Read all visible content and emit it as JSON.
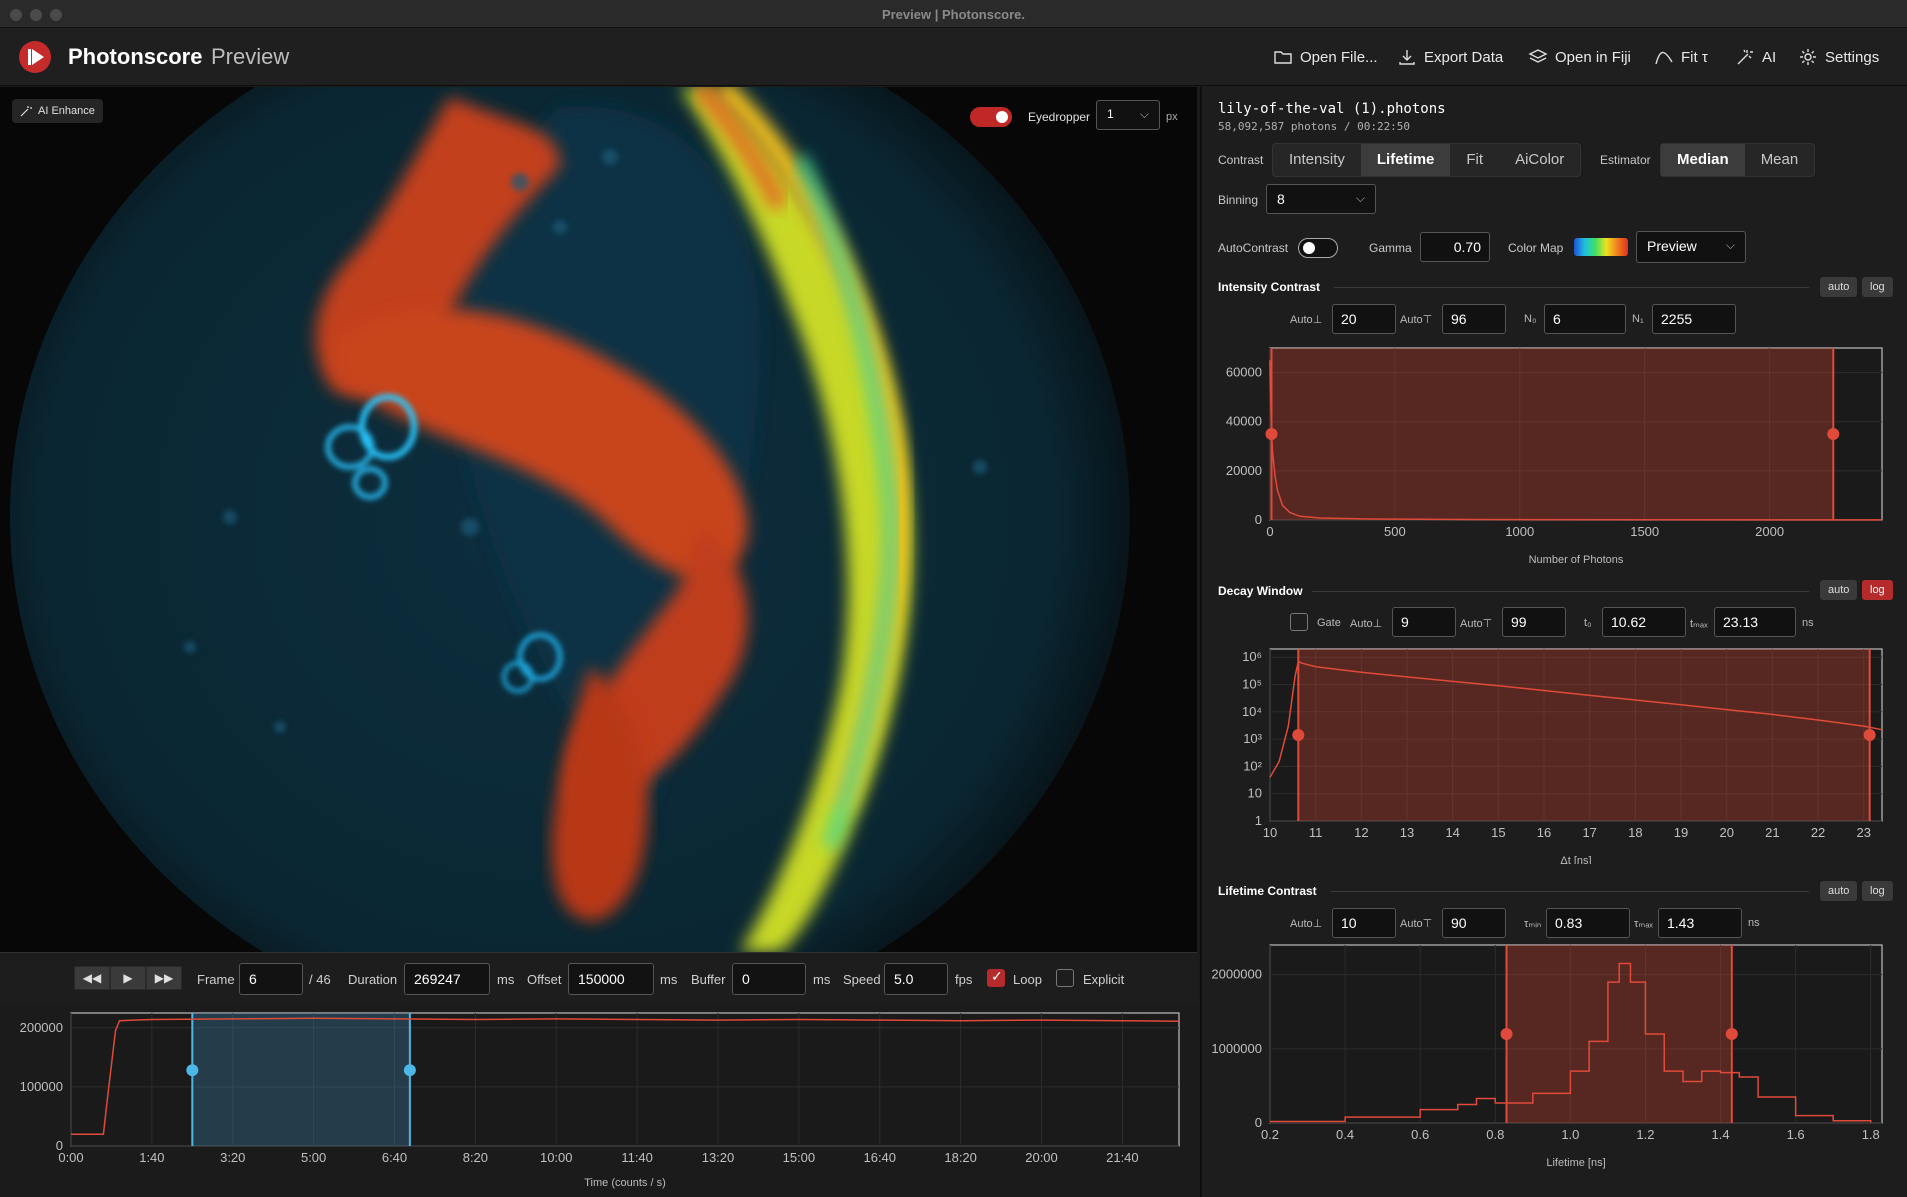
{
  "window_title": "Preview | Photonscore.",
  "app": {
    "brand": "Photonscore",
    "mode": "Preview"
  },
  "toolbar": [
    {
      "label": "Open File...",
      "icon": "folder-icon"
    },
    {
      "label": "Export Data",
      "icon": "download-icon"
    },
    {
      "label": "Open in Fiji",
      "icon": "layers-icon"
    },
    {
      "label": "Fit τ",
      "icon": "curve-icon"
    },
    {
      "label": "AI",
      "icon": "magic-wand-icon"
    },
    {
      "label": "Settings",
      "icon": "gear-icon"
    }
  ],
  "image_panel": {
    "ai_enhance_label": "AI Enhance",
    "eyedropper_label": "Eyedropper",
    "eyedropper_size": "1",
    "eyedropper_unit": "px",
    "eyedropper_on": true
  },
  "playback": {
    "frame_label": "Frame",
    "frame": "6",
    "frame_total": "/ 46",
    "duration_label": "Duration",
    "duration": "269247",
    "duration_unit": "ms",
    "offset_label": "Offset",
    "offset": "150000",
    "offset_unit": "ms",
    "buffer_label": "Buffer",
    "buffer": "0",
    "buffer_unit": "ms",
    "speed_label": "Speed",
    "speed": "5.0",
    "speed_unit": "fps",
    "loop_label": "Loop",
    "loop_checked": true,
    "explicit_label": "Explicit",
    "explicit_checked": false
  },
  "file": {
    "name": "lily-of-the-val (1).photons",
    "meta": "58,092,587 photons  /  00:22:50"
  },
  "contrast": {
    "label": "Contrast",
    "options": [
      "Intensity",
      "Lifetime",
      "Fit",
      "AiColor"
    ],
    "selected": "Lifetime"
  },
  "estimator": {
    "label": "Estimator",
    "options": [
      "Median",
      "Mean"
    ],
    "selected": "Median"
  },
  "binning": {
    "label": "Binning",
    "value": "8"
  },
  "autocontrast": {
    "label": "AutoContrast",
    "on": false
  },
  "gamma": {
    "label": "Gamma",
    "value": "0.70"
  },
  "colormap": {
    "label": "Color Map",
    "value": "Preview"
  },
  "intensity_contrast": {
    "title": "Intensity Contrast",
    "auto_btn": "auto",
    "log_btn": "log",
    "log_active": false,
    "auto_low_label": "Auto⊥",
    "auto_low": "20",
    "auto_high_label": "Auto⊤",
    "auto_high": "96",
    "n0_label": "N₀",
    "n0": "6",
    "n1_label": "N₁",
    "n1": "2255"
  },
  "decay_window": {
    "title": "Decay Window",
    "auto_btn": "auto",
    "log_btn": "log",
    "log_active": true,
    "gate_label": "Gate",
    "gate_checked": false,
    "auto_low_label": "Auto⊥",
    "auto_low": "9",
    "auto_high_label": "Auto⊤",
    "auto_high": "99",
    "t0_label": "t₀",
    "t0": "10.62",
    "tmax_label": "tₘₐₓ",
    "tmax": "23.13",
    "unit": "ns"
  },
  "lifetime_contrast": {
    "title": "Lifetime Contrast",
    "auto_btn": "auto",
    "log_btn": "log",
    "log_active": false,
    "auto_low_label": "Auto⊥",
    "auto_low": "10",
    "auto_high_label": "Auto⊤",
    "auto_high": "90",
    "tmin_label": "τₘᵢₙ",
    "tmin": "0.83",
    "tmax_label": "τₘₐₓ",
    "tmax": "1.43",
    "unit": "ns"
  },
  "chart_data": [
    {
      "id": "timeline",
      "type": "line",
      "xlabel": "Time  (counts / s)",
      "xticks": [
        "0:00",
        "1:40",
        "3:20",
        "5:00",
        "6:40",
        "8:20",
        "10:00",
        "11:40",
        "13:20",
        "15:00",
        "16:40",
        "18:20",
        "20:00",
        "21:40"
      ],
      "xlim": [
        0,
        1370
      ],
      "yticks": [
        "0",
        "100000",
        "200000"
      ],
      "ylim": [
        0,
        225000
      ],
      "selection": [
        150,
        419
      ],
      "x": [
        0,
        40,
        45,
        55,
        60,
        100,
        200,
        300,
        400,
        500,
        600,
        700,
        800,
        900,
        1000,
        1100,
        1200,
        1300,
        1370
      ],
      "y": [
        20000,
        20000,
        80000,
        195000,
        212000,
        214000,
        215000,
        216000,
        215000,
        214000,
        215000,
        214000,
        213000,
        214000,
        213000,
        212000,
        213000,
        212000,
        211000
      ]
    },
    {
      "id": "intensity-histogram",
      "type": "area",
      "xlabel": "Number of Photons",
      "xticks": [
        "0",
        "500",
        "1000",
        "1500",
        "2000"
      ],
      "xlim": [
        0,
        2450
      ],
      "yticks": [
        "0",
        "20000",
        "40000",
        "60000"
      ],
      "ylim": [
        0,
        70000
      ],
      "range": [
        6,
        2255
      ],
      "x": [
        0,
        5,
        10,
        20,
        30,
        50,
        80,
        120,
        200,
        400,
        800,
        1500,
        2450
      ],
      "y": [
        65000,
        40000,
        28000,
        18000,
        12000,
        6000,
        3000,
        1500,
        800,
        400,
        200,
        100,
        50
      ]
    },
    {
      "id": "decay-histogram",
      "type": "line",
      "xlabel": "Δt [ns]",
      "xticks": [
        "10",
        "11",
        "12",
        "13",
        "14",
        "15",
        "16",
        "17",
        "18",
        "19",
        "20",
        "21",
        "22",
        "23"
      ],
      "xlim": [
        10,
        23.4
      ],
      "yticks": [
        "1",
        "10",
        "10²",
        "10³",
        "10⁴",
        "10⁵",
        "10⁶"
      ],
      "ylog": true,
      "range": [
        10.62,
        23.13
      ],
      "x": [
        10.0,
        10.2,
        10.4,
        10.55,
        10.62,
        10.7,
        11,
        12,
        13,
        14,
        15,
        16,
        17,
        18,
        19,
        20,
        21,
        22,
        23,
        23.4
      ],
      "y": [
        40,
        150,
        3000,
        200000,
        700000,
        600000,
        450000,
        280000,
        190000,
        130000,
        90000,
        60000,
        40000,
        27000,
        18000,
        12000,
        8000,
        5000,
        3000,
        2200
      ]
    },
    {
      "id": "lifetime-histogram",
      "type": "area",
      "xlabel": "Lifetime [ns]",
      "xticks": [
        "0.2",
        "0.4",
        "0.6",
        "0.8",
        "1.0",
        "1.2",
        "1.4",
        "1.6",
        "1.8"
      ],
      "xlim": [
        0.2,
        1.83
      ],
      "yticks": [
        "0",
        "1000000",
        "2000000"
      ],
      "ylim": [
        0,
        2400000
      ],
      "range": [
        0.83,
        1.43
      ],
      "x": [
        0.2,
        0.4,
        0.6,
        0.7,
        0.75,
        0.8,
        0.9,
        1.0,
        1.05,
        1.1,
        1.13,
        1.16,
        1.2,
        1.25,
        1.3,
        1.35,
        1.4,
        1.45,
        1.5,
        1.6,
        1.7,
        1.8
      ],
      "y": [
        20000,
        80000,
        180000,
        250000,
        330000,
        270000,
        400000,
        700000,
        1100000,
        1900000,
        2150000,
        1900000,
        1200000,
        700000,
        560000,
        700000,
        680000,
        620000,
        350000,
        100000,
        30000,
        5000
      ]
    }
  ]
}
